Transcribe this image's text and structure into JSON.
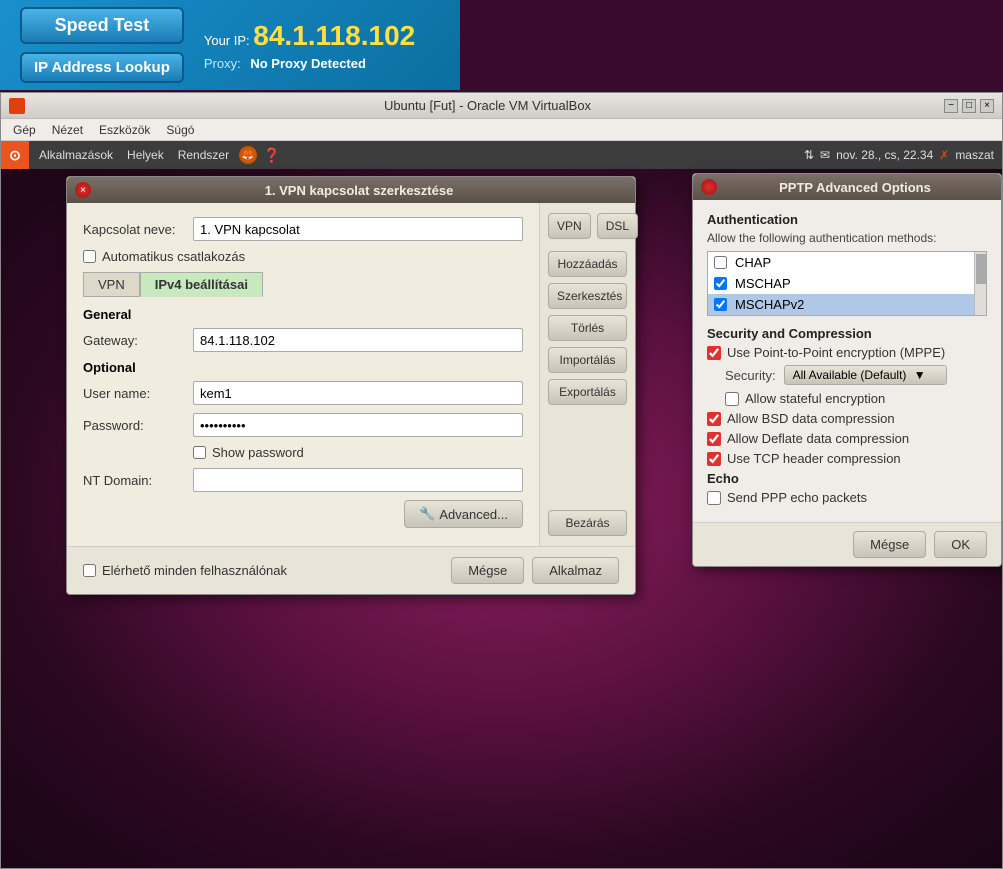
{
  "banner": {
    "your_ip_label": "Your IP:",
    "ip_address": "84.1.118.102",
    "proxy_label": "Proxy:",
    "proxy_value": "No Proxy Detected",
    "speed_test": "Speed Test",
    "ip_lookup": "IP Address Lookup"
  },
  "vbox": {
    "title": "Ubuntu [Fut] - Oracle VM VirtualBox",
    "menu": {
      "items": [
        "Gép",
        "Nézet",
        "Eszközök",
        "Súgó"
      ]
    }
  },
  "ubuntu": {
    "panel": {
      "logo": "⊙",
      "menu_items": [
        "Alkalmazások",
        "Helyek",
        "Rendszer"
      ],
      "right": "nov. 28., cs, 22.34",
      "user": "maszat"
    }
  },
  "vpn_dialog": {
    "title": "1. VPN kapcsolat szerkesztése",
    "connection_name_label": "Kapcsolat neve:",
    "connection_name_value": "1. VPN kapcsolat",
    "auto_connect_label": "Automatikus csatlakozás",
    "tabs": [
      "VPN",
      "IPv4 beállításai"
    ],
    "general_title": "General",
    "gateway_label": "Gateway:",
    "gateway_value": "84.1.118.102",
    "optional_title": "Optional",
    "username_label": "User name:",
    "username_value": "kem1",
    "password_label": "Password:",
    "password_value": "••••••••••",
    "show_password_label": "Show password",
    "nt_domain_label": "NT Domain:",
    "nt_domain_value": "",
    "advanced_btn": "Advanced...",
    "footer": {
      "available_label": "Elérhető minden felhasználónak",
      "cancel_btn": "Mégse",
      "apply_btn": "Alkalmaz"
    },
    "right_buttons": [
      "Hozzáadás",
      "Szerkesztés",
      "Törlés",
      "Importálás",
      "Exportálás",
      "Bezárás"
    ],
    "vpn_tab_label": "VPN",
    "dsl_tab_label": "DSL"
  },
  "pptp_dialog": {
    "title": "PPTP Advanced Options",
    "auth_section_title": "Authentication",
    "auth_subtitle": "Allow the following authentication methods:",
    "auth_items": [
      {
        "label": "CHAP",
        "checked": false,
        "selected": false
      },
      {
        "label": "MSCHAP",
        "checked": true,
        "selected": false
      },
      {
        "label": "MSCHAPv2",
        "checked": true,
        "selected": true
      }
    ],
    "security_section_title": "Security and Compression",
    "use_mppe_label": "Use Point-to-Point encryption (MPPE)",
    "use_mppe_checked": true,
    "security_label": "Security:",
    "security_value": "All Available (Default)",
    "allow_stateful_label": "Allow stateful encryption",
    "allow_stateful_checked": false,
    "allow_bsd_label": "Allow BSD data compression",
    "allow_bsd_checked": true,
    "allow_deflate_label": "Allow Deflate data compression",
    "allow_deflate_checked": true,
    "use_tcp_label": "Use TCP header compression",
    "use_tcp_checked": true,
    "echo_section_title": "Echo",
    "send_ppp_label": "Send PPP echo packets",
    "send_ppp_checked": false,
    "cancel_btn": "Mégse",
    "ok_btn": "OK"
  }
}
